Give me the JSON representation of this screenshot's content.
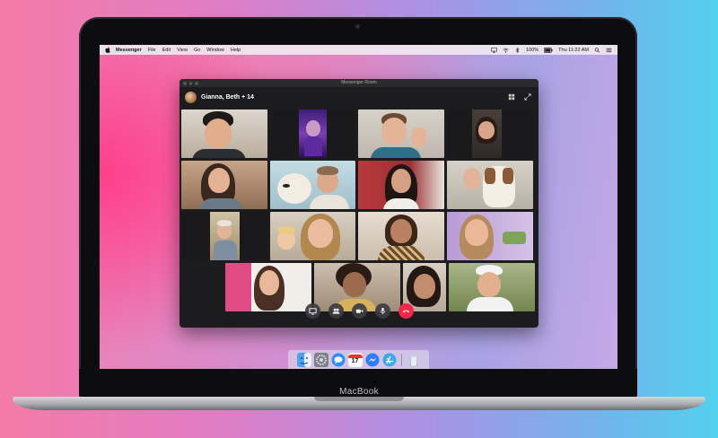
{
  "menubar": {
    "app": "Messenger",
    "items": [
      "File",
      "Edit",
      "View",
      "Go",
      "Window",
      "Help"
    ],
    "battery": "100%",
    "clock": "Thu 11:22 AM"
  },
  "window": {
    "title": "Messenger Room",
    "room_name": "Gianna, Beth + 14"
  },
  "controls": [
    "share-screen",
    "participants",
    "camera",
    "microphone",
    "end-call"
  ],
  "dock": {
    "calendar_day": "17",
    "apps": [
      "Finder",
      "System Preferences",
      "Messages",
      "Calendar",
      "Messenger",
      "App",
      "Trash"
    ]
  },
  "device": {
    "label": "MacBook"
  },
  "colors": {
    "end_call": "#f02849",
    "window_bg": "#1c1c1e"
  }
}
